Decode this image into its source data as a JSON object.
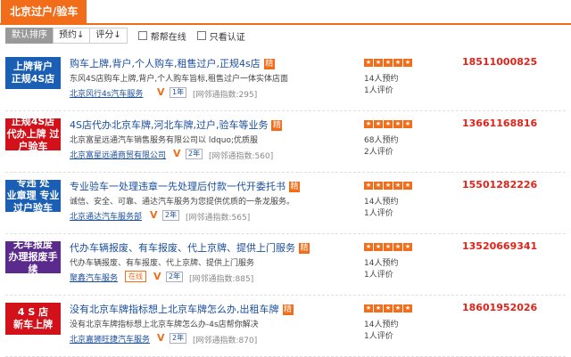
{
  "header": {
    "tab": "北京过户/验车"
  },
  "sort": {
    "buttons": [
      "默认排序",
      "预约↓",
      "评分↓"
    ],
    "checks": [
      "帮帮在线",
      "只看认证"
    ]
  },
  "listings": [
    {
      "logo": {
        "line1": "上牌背户",
        "line2": "正规4S店",
        "bg": "#1b5fb4"
      },
      "title": "购车上牌,背户,个人购车,租售过户,正规4s店",
      "tag": "精",
      "desc": "东风4S店购车上牌,背户,个人购车旨标,租售过户一体实体店面",
      "company": "北京风行4s汽车服务",
      "year": "1年",
      "chat": "",
      "index": "[网邻通指数:295]",
      "stars": 5,
      "reserve": "14人预约",
      "reviews": "1人评价",
      "phone": "18511000825"
    },
    {
      "logo": {
        "line1": "正规4S店",
        "line2": "代办上牌 过户验车",
        "bg": "#d2111a"
      },
      "title": "4S店代办北京车牌,河北车牌,过户,验车等业务",
      "tag": "精",
      "desc": "北京富星远通汽车销售服务有限公司以 ldquo;优质服",
      "company": "北京富星远通商贸有限公司",
      "year": "2年",
      "chat": "",
      "index": "[网邻通指数:560]",
      "stars": 5,
      "reserve": "68人预约",
      "reviews": "2人评价",
      "phone": "13661168816"
    },
    {
      "logo": {
        "line1": "专违 处",
        "line2": "业章理 专业过户验车",
        "bg": "#1b5fb4"
      },
      "title": "专业验车一处理违章一先处理后付款一代开委托书",
      "tag": "精",
      "desc": "诚信、安全、可靠、通达汽车服务为您提供优质的一条龙服务。",
      "company": "北京通达汽车服务部",
      "year": "2年",
      "chat": "",
      "index": "[网邻通指数:565]",
      "stars": 5,
      "reserve": "14人预约",
      "reviews": "1人评价",
      "phone": "15501282226"
    },
    {
      "logo": {
        "line1": "无车报废",
        "line2": "办理报废手续",
        "bg": "#5a2a8c"
      },
      "title": "代办车辆报废、有车报废、代上京牌、提供上门服务",
      "tag": "精",
      "desc": "代办车辆报废、有车报废、代上京牌、提供上门服务",
      "company": "聚鑫汽车服务",
      "year": "2年",
      "chat": "在线",
      "index": "[网邻通指数:885]",
      "stars": 5,
      "reserve": "14人预约",
      "reviews": "1人评价",
      "phone": "13520669341"
    },
    {
      "logo": {
        "line1": "4 S 店",
        "line2": "新车上牌",
        "bg": "#d2111a"
      },
      "title": "没有北京车牌指标想上北京车牌怎么办,出租车牌",
      "tag": "精",
      "desc": "没有北京车牌指标想上北京车牌怎么办-4s店帮你解决",
      "company": "北京嘉狮旺捷汽车服务",
      "year": "2年",
      "chat": "",
      "index": "[网邻通指数:870]",
      "stars": 5,
      "reserve": "14人预约",
      "reviews": "1人评价",
      "phone": "18601952026"
    }
  ]
}
